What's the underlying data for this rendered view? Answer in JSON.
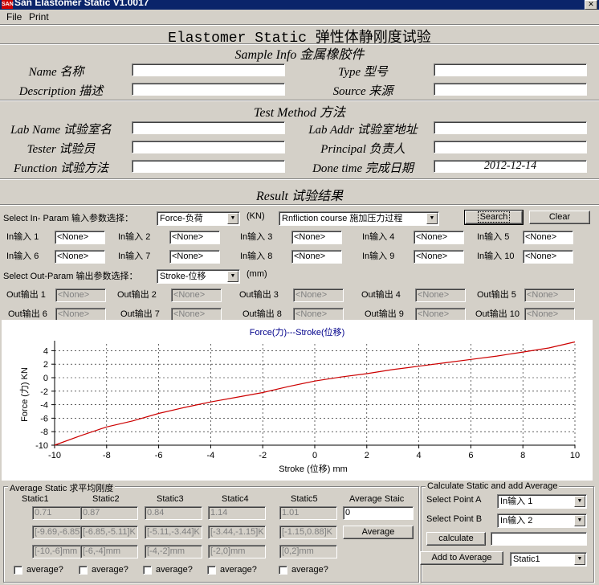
{
  "window": {
    "title": "San Elastomer Static V1.0017",
    "icon": "app-icon"
  },
  "menu": [
    "File",
    "Print"
  ],
  "header": {
    "title": "Elastomer Static 弹性体静刚度试验"
  },
  "sample_info": {
    "heading": "Sample Info 金属橡胶件",
    "name_label": "Name 名称",
    "name_value": "",
    "type_label": "Type 型号",
    "type_value": "",
    "desc_label": "Description 描述",
    "desc_value": "",
    "source_label": "Source 来源",
    "source_value": ""
  },
  "test_method": {
    "heading": "Test Method 方法",
    "lab_name_label": "Lab Name 试验室名",
    "lab_name_value": "",
    "lab_addr_label": "Lab Addr 试验室地址",
    "lab_addr_value": "",
    "tester_label": "Tester 试验员",
    "tester_value": "",
    "principal_label": "Principal 负责人",
    "principal_value": "",
    "function_label": "Function 试验方法",
    "function_value": "",
    "done_time_label": "Done time 完成日期",
    "done_time_value": "2012-12-14"
  },
  "result": {
    "heading": "Result 试验结果",
    "in_select_label": "Select In- Param 输入参数选择：",
    "in_select_value": "Force-负荷",
    "in_unit": "(KN)",
    "course_value": "Rnfliction course 施加压力过程",
    "search_label": "Search",
    "clear_label": "Clear",
    "inputs": [
      {
        "label": "In输入 1",
        "value": "<None>"
      },
      {
        "label": "In输入 2",
        "value": "<None>"
      },
      {
        "label": "In输入 3",
        "value": "<None>"
      },
      {
        "label": "In输入 4",
        "value": "<None>"
      },
      {
        "label": "In输入 5",
        "value": "<None>"
      },
      {
        "label": "In输入 6",
        "value": "<None>"
      },
      {
        "label": "In输入 7",
        "value": "<None>"
      },
      {
        "label": "In输入 8",
        "value": "<None>"
      },
      {
        "label": "In输入 9",
        "value": "<None>"
      },
      {
        "label": "In输入 10",
        "value": "<None>"
      }
    ],
    "out_select_label": "Select Out-Param 输出参数选择：",
    "out_select_value": "Stroke-位移",
    "out_unit": "(mm)",
    "outputs": [
      {
        "label": "Out输出 1",
        "value": "<None>"
      },
      {
        "label": "Out输出 2",
        "value": "<None>"
      },
      {
        "label": "Out输出 3",
        "value": "<None>"
      },
      {
        "label": "Out输出 4",
        "value": "<None>"
      },
      {
        "label": "Out输出 5",
        "value": "<None>"
      },
      {
        "label": "Out输出 6",
        "value": "<None>"
      },
      {
        "label": "Out输出 7",
        "value": "<None>"
      },
      {
        "label": "Out输出 8",
        "value": "<None>"
      },
      {
        "label": "Out输出 9",
        "value": "<None>"
      },
      {
        "label": "Out输出 10",
        "value": "<None>"
      }
    ]
  },
  "chart_data": {
    "type": "line",
    "title": "Force(力)---Stroke(位移)",
    "xlabel": "Stroke (位移)    mm",
    "ylabel": "Force (力)    KN",
    "xlim": [
      -10,
      10
    ],
    "ylim": [
      -10,
      5
    ],
    "xticks": [
      -10,
      -8,
      -6,
      -4,
      -2,
      0,
      2,
      4,
      6,
      8,
      10
    ],
    "yticks": [
      4,
      2,
      0,
      -2,
      -4,
      -6,
      -8,
      -10
    ],
    "grid": true,
    "line_color": "#cc0000",
    "x": [
      -10,
      -9,
      -8,
      -7,
      -6,
      -5,
      -4,
      -3,
      -2,
      -1,
      0,
      1,
      2,
      3,
      4,
      5,
      6,
      7,
      8,
      9,
      10
    ],
    "y": [
      -10,
      -8.6,
      -7.3,
      -6.4,
      -5.3,
      -4.4,
      -3.6,
      -2.9,
      -2.2,
      -1.3,
      -0.5,
      0.1,
      0.6,
      1.2,
      1.7,
      2.2,
      2.7,
      3.2,
      3.8,
      4.4,
      5.3
    ]
  },
  "average_static": {
    "legend": "Average Static 求平均刚度",
    "columns": [
      {
        "title": "Static1",
        "value": "0.71",
        "range": "[-9.69,-6.85]K",
        "mm": "[-10,-6]mm",
        "avg_label": "average?"
      },
      {
        "title": "Static2",
        "value": "0.87",
        "range": "[-6.85,-5.11]K",
        "mm": "[-6,-4]mm",
        "avg_label": "average?"
      },
      {
        "title": "Static3",
        "value": "0.84",
        "range": "[-5.11,-3.44]K",
        "mm": "[-4,-2]mm",
        "avg_label": "average?"
      },
      {
        "title": "Static4",
        "value": "1.14",
        "range": "[-3.44,-1.15]K",
        "mm": "[-2,0]mm",
        "avg_label": "average?"
      },
      {
        "title": "Static5",
        "value": "1.01",
        "range": "[-1.15,0.88]K",
        "mm": "[0,2]mm",
        "avg_label": "average?"
      }
    ],
    "avg_title": "Average Staic",
    "avg_value": "0",
    "average_button": "Average"
  },
  "calc_panel": {
    "legend": "Calculate Static and add  Average",
    "point_a_label": "Select Point A",
    "point_a_value": "In输入 1",
    "point_b_label": "Select Point B",
    "point_b_value": "In输入 2",
    "calculate_button": "calculate",
    "calc_result": "",
    "add_button": "Add to Average",
    "static_select": "Static1"
  }
}
